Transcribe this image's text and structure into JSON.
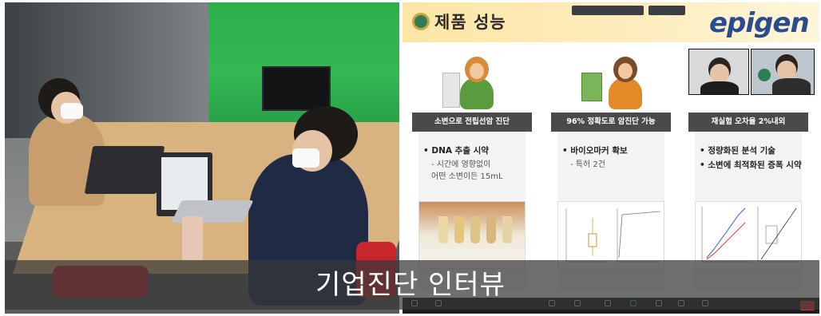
{
  "caption": "기업진단 인터뷰",
  "slide": {
    "title": "제품 성능",
    "brand": "epigen",
    "top_pills": [
      "",
      ""
    ],
    "columns": [
      {
        "label": "소변으로 전립선암 진단",
        "bullets": [
          {
            "text": "DNA 추출 시약",
            "subs": [
              "- 시간에 영향없이",
              "어떤 소변이든 15mL"
            ]
          }
        ]
      },
      {
        "label": "96% 정확도로 암진단 가능",
        "bullets": [
          {
            "text": "바이오마커 확보",
            "subs": [
              "- 특허 2건"
            ]
          }
        ]
      },
      {
        "label": "재실험 오차율 2%내외",
        "bullets": [
          {
            "text": "정량화된 분석 기술",
            "subs": []
          },
          {
            "text": "소변에 최적화된 증폭 시약",
            "subs": []
          }
        ]
      }
    ],
    "colors": {
      "header": "#fde6a6",
      "label_bg": "#4a4a4a",
      "brand": "#2b4c8c"
    }
  }
}
